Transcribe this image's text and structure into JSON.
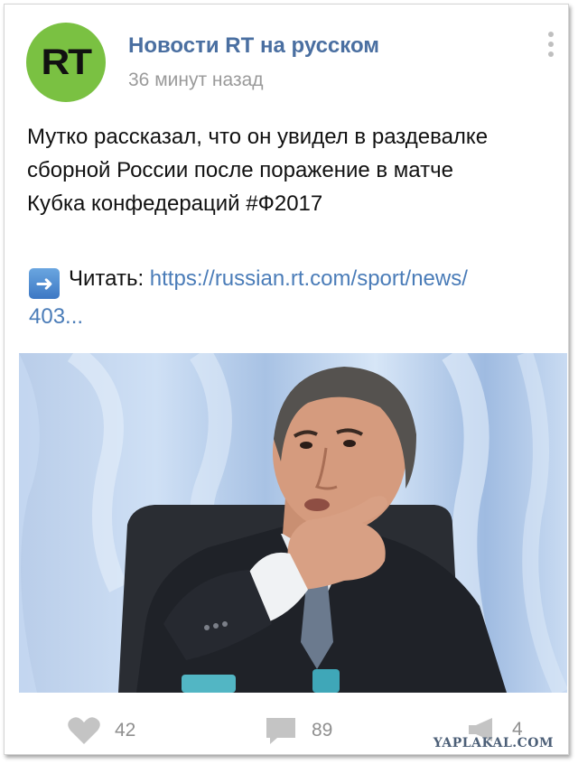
{
  "post": {
    "source_name": "Новости RT на русском",
    "avatar_text": "RT",
    "timestamp": "36 минут назад",
    "text_lines": [
      "Мутко рассказал, что он увидел в раздевалке",
      "сборной России после поражение в матче",
      "Кубка конфедераций #Ф2017"
    ],
    "read_label": "Читать:",
    "link_line1": "https://russian.rt.com/sport/news/",
    "link_line2": "403..."
  },
  "footer": {
    "likes": "42",
    "comments": "89",
    "shares": "4",
    "watermark": "YAPLAKAL.COM"
  },
  "icons": {
    "more": "more-vertical-icon",
    "arrow": "arrow-right-icon",
    "like": "heart-icon",
    "comment": "comment-icon",
    "share": "megaphone-icon"
  },
  "colors": {
    "avatar_bg": "#7ac142",
    "source_name": "#4a6fa1",
    "link": "#4a7cb8",
    "meta_gray": "#9a9a9a"
  }
}
